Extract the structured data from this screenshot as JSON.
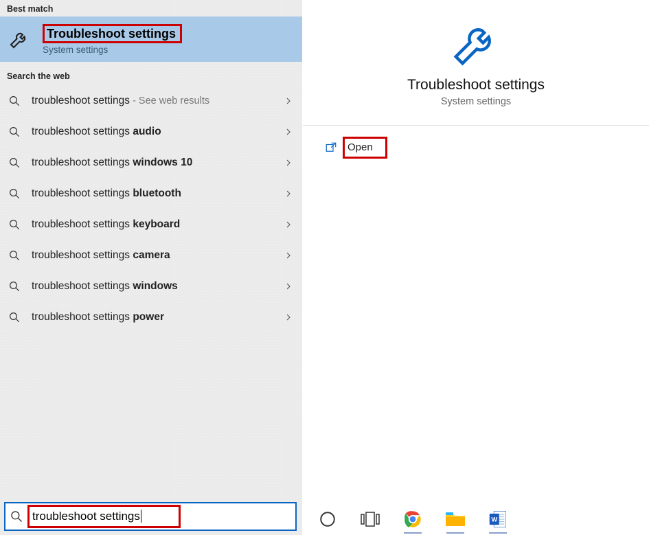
{
  "left": {
    "bestMatchHeader": "Best match",
    "bestMatch": {
      "title": "Troubleshoot settings",
      "subtitle": "System settings"
    },
    "webHeader": "Search the web",
    "webItems": [
      {
        "prefix": "troubleshoot settings",
        "bold": "",
        "suffix": " - See web results"
      },
      {
        "prefix": "troubleshoot settings ",
        "bold": "audio",
        "suffix": ""
      },
      {
        "prefix": "troubleshoot settings ",
        "bold": "windows 10",
        "suffix": ""
      },
      {
        "prefix": "troubleshoot settings ",
        "bold": "bluetooth",
        "suffix": ""
      },
      {
        "prefix": "troubleshoot settings ",
        "bold": "keyboard",
        "suffix": ""
      },
      {
        "prefix": "troubleshoot settings ",
        "bold": "camera",
        "suffix": ""
      },
      {
        "prefix": "troubleshoot settings ",
        "bold": "windows",
        "suffix": ""
      },
      {
        "prefix": "troubleshoot settings ",
        "bold": "power",
        "suffix": ""
      }
    ],
    "searchValue": "troubleshoot settings"
  },
  "right": {
    "title": "Troubleshoot settings",
    "subtitle": "System settings",
    "actions": {
      "open": "Open"
    }
  },
  "taskbar": {
    "items": [
      "cortana-icon",
      "taskview-icon",
      "chrome-icon",
      "explorer-icon",
      "word-icon"
    ]
  },
  "colors": {
    "highlightBox": "#cc0000",
    "selection": "#a9c9e8",
    "accent": "#0a66c2"
  }
}
